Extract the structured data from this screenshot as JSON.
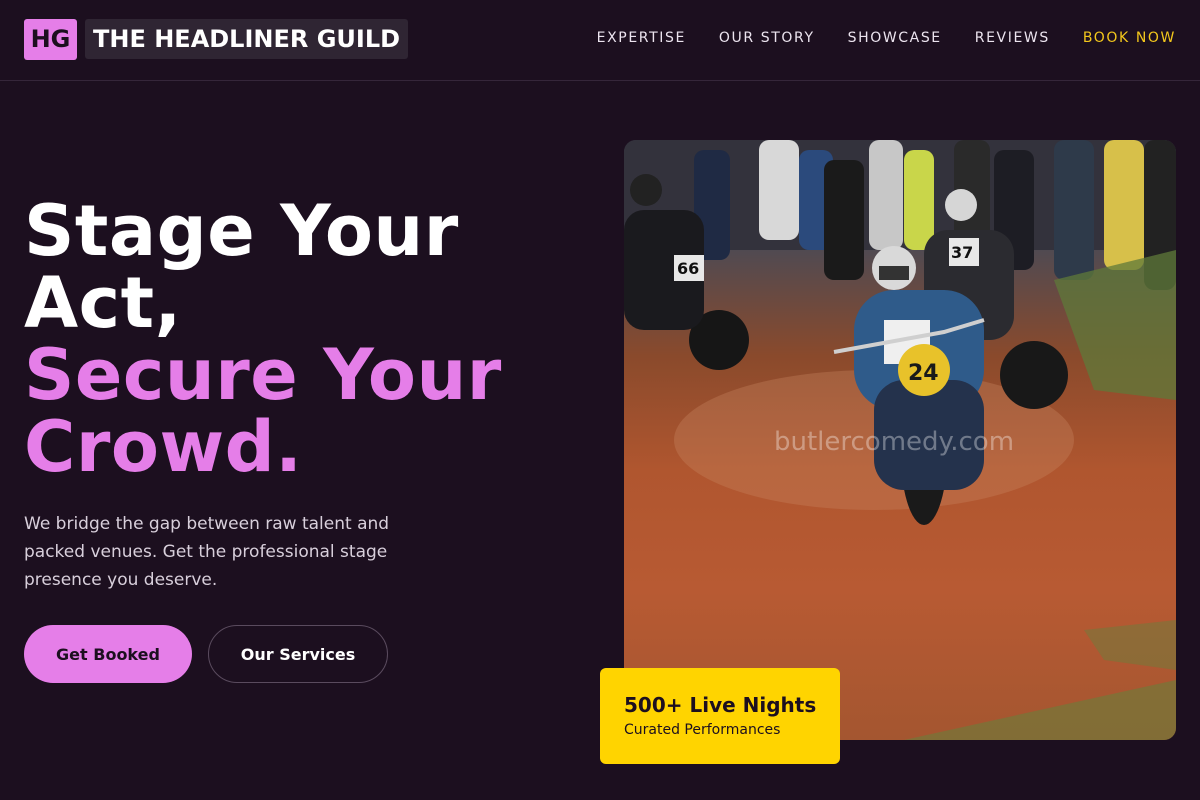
{
  "brand": {
    "mark": "HG",
    "name": "THE HEADLINER GUILD"
  },
  "nav": {
    "items": [
      "EXPERTISE",
      "OUR STORY",
      "SHOWCASE",
      "REVIEWS"
    ],
    "cta": "BOOK NOW"
  },
  "hero": {
    "title_line1": "Stage Your",
    "title_line2": "Act,",
    "title_line3": "Secure Your",
    "title_line4": "Crowd.",
    "description": "We bridge the gap between raw talent and packed venues. Get the professional stage presence you deserve.",
    "primary_button": "Get Booked",
    "secondary_button": "Our Services"
  },
  "photo": {
    "watermark": "butlercomedy.com",
    "rider_number": "24",
    "rider2_number": "37",
    "rider3_number": "66"
  },
  "stat": {
    "value": "500+ Live Nights",
    "label": "Curated Performances"
  },
  "colors": {
    "background": "#1c0f1f",
    "accent": "#e57ee8",
    "cta": "#f3c71c",
    "stat_card": "#ffd400"
  }
}
